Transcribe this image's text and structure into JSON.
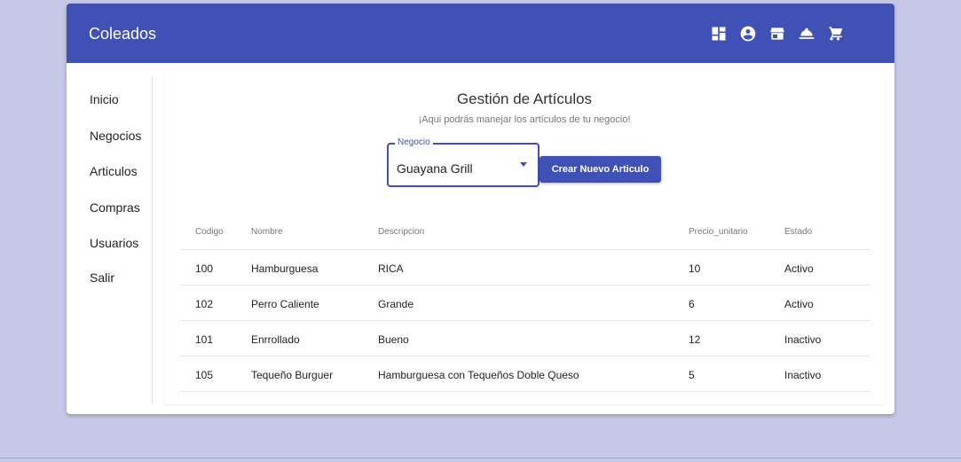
{
  "app": {
    "title": "Coleados"
  },
  "nav_icons": [
    "dashboard-icon",
    "account-circle-icon",
    "store-icon",
    "room-service-icon",
    "shopping-cart-icon"
  ],
  "sidebar": {
    "items": [
      {
        "label": "Inicio"
      },
      {
        "label": "Negocios"
      },
      {
        "label": "Articulos"
      },
      {
        "label": "Compras"
      },
      {
        "label": "Usuarios"
      },
      {
        "label": "Salir"
      }
    ]
  },
  "main": {
    "title": "Gestión de Artículos",
    "subtitle": "¡Aqui podrás manejar los artículos de tu negocio!",
    "select": {
      "label": "Negocio",
      "value": "Guayana Grill"
    },
    "create_button": "Crear Nuevo Articulo"
  },
  "table": {
    "headers": [
      "Codigo",
      "Nombre",
      "Descripcion",
      "Precio_unitario",
      "Estado"
    ],
    "rows": [
      [
        "100",
        "Hamburguesa",
        "RICA",
        "10",
        "Activo"
      ],
      [
        "102",
        "Perro Caliente",
        "Grande",
        "6",
        "Activo"
      ],
      [
        "101",
        "Enrrollado",
        "Bueno",
        "12",
        "Inactivo"
      ],
      [
        "105",
        "Tequeño Burguer",
        "Hamburguesa con Tequeños Doble Queso",
        "5",
        "Inactivo"
      ]
    ]
  },
  "colors": {
    "primary": "#3f51b5",
    "background": "#c5c8e6"
  }
}
